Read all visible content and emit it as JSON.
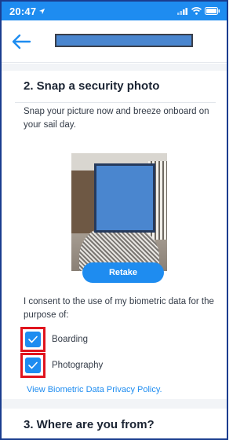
{
  "status_bar": {
    "time": "20:47"
  },
  "nav": {},
  "section": {
    "title": "2. Snap a security photo",
    "intro": "Snap your picture now and breeze onboard on your sail day.",
    "retake_label": "Retake",
    "consent_text": "I consent to the use of my biometric data for the purpose of:",
    "options": [
      {
        "label": "Boarding",
        "checked": true
      },
      {
        "label": "Photography",
        "checked": true
      }
    ],
    "privacy_link": "View Biometric Data Privacy Policy."
  },
  "next_section": {
    "title": "3. Where are you from?"
  },
  "colors": {
    "accent": "#1e8cf0",
    "highlight": "#e0141e",
    "redaction": "#4a86cf"
  },
  "icons": [
    "location-arrow-icon",
    "signal-icon",
    "wifi-icon",
    "battery-icon",
    "back-arrow-icon",
    "checkmark-icon"
  ]
}
